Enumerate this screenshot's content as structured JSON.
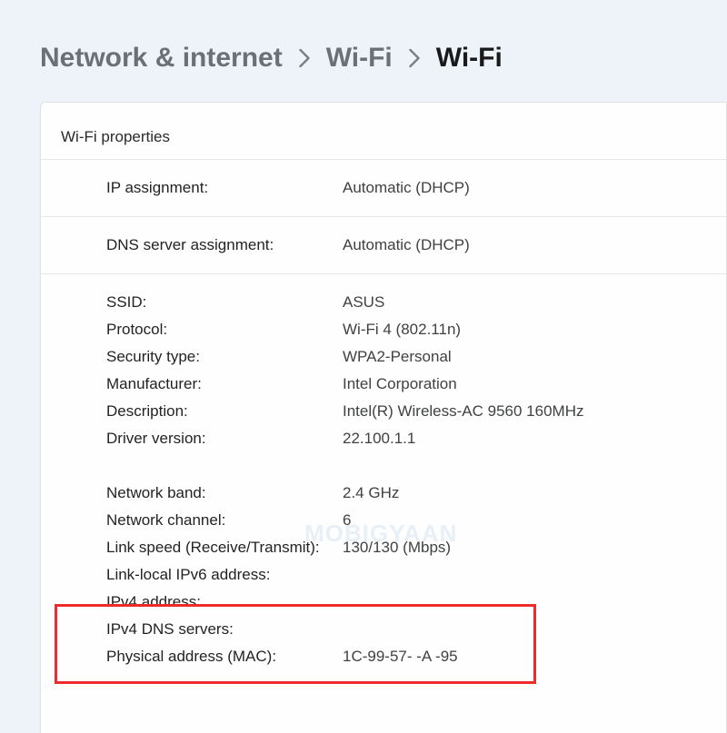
{
  "breadcrumb": {
    "root": "Network & internet",
    "mid": "Wi-Fi",
    "current": "Wi-Fi"
  },
  "panel": {
    "title": "Wi-Fi properties"
  },
  "config": {
    "ip_label": "IP assignment:",
    "ip_value": "Automatic (DHCP)",
    "dns_label": "DNS server assignment:",
    "dns_value": "Automatic (DHCP)"
  },
  "details": [
    {
      "label": "SSID:",
      "value": "ASUS"
    },
    {
      "label": "Protocol:",
      "value": "Wi-Fi 4 (802.11n)"
    },
    {
      "label": "Security type:",
      "value": "WPA2-Personal"
    },
    {
      "label": "Manufacturer:",
      "value": "Intel Corporation"
    },
    {
      "label": "Description:",
      "value": "Intel(R) Wireless-AC 9560 160MHz"
    },
    {
      "label": "Driver version:",
      "value": "22.100.1.1"
    }
  ],
  "net": [
    {
      "label": "Network band:",
      "value": "2.4 GHz"
    },
    {
      "label": "Network channel:",
      "value": "6"
    },
    {
      "label": "Link speed (Receive/Transmit):",
      "value": "130/130 (Mbps)"
    },
    {
      "label": "Link-local IPv6 address:",
      "value": ""
    },
    {
      "label": "IPv4 address:",
      "value": ""
    },
    {
      "label": "IPv4 DNS servers:",
      "value": ""
    },
    {
      "label": "Physical address (MAC):",
      "value": "1C-99-57-   -A   -95"
    }
  ],
  "watermark": "MOBIGYAAN"
}
